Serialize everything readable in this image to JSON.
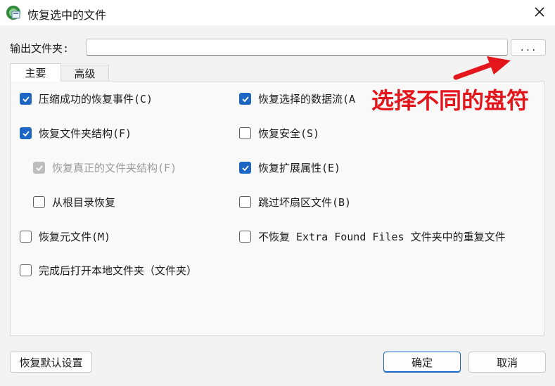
{
  "window": {
    "title": "恢复选中的文件",
    "app_icon": "recovery-app-icon",
    "close_icon": "close-icon"
  },
  "output": {
    "label": "输出文件夹:",
    "value": "",
    "browse_label": "..."
  },
  "tabs": [
    {
      "label": "主要",
      "active": true
    },
    {
      "label": "高级",
      "active": false
    }
  ],
  "options_left": [
    {
      "label": "压缩成功的恢复事件(C)",
      "state": "checked"
    },
    {
      "label": "恢复文件夹结构(F)",
      "state": "checked"
    },
    {
      "label": "恢复真正的文件夹结构(F)",
      "state": "disabled-checked"
    },
    {
      "label": "从根目录恢复",
      "state": "unchecked"
    },
    {
      "label": "恢复元文件(M)",
      "state": "unchecked"
    },
    {
      "label": "完成后打开本地文件夹（文件夹）",
      "state": "unchecked"
    }
  ],
  "options_right": [
    {
      "label": "恢复选择的数据流(A",
      "state": "checked"
    },
    {
      "label": "恢复安全(S)",
      "state": "unchecked"
    },
    {
      "label": "恢复扩展属性(E)",
      "state": "checked"
    },
    {
      "label": "跳过坏扇区文件(B)",
      "state": "unchecked"
    },
    {
      "label": "不恢复 Extra Found Files 文件夹中的重复文件",
      "state": "unchecked"
    }
  ],
  "annotation": {
    "text": "选择不同的盘符",
    "color": "#e3161b"
  },
  "footer": {
    "reset_label": "恢复默认设置",
    "ok_label": "确定",
    "cancel_label": "取消"
  },
  "colors": {
    "accent": "#1e66c4"
  }
}
